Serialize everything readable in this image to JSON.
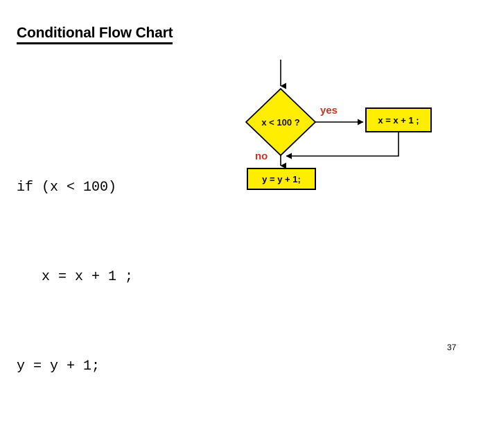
{
  "slide": {
    "title": "Conditional Flow Chart",
    "page_number": "37",
    "background_color": "#ffffff"
  },
  "code": {
    "lines": [
      "if (x < 100)",
      "   x = x + 1 ;",
      "y = y + 1;"
    ],
    "line1": "if (x < 100)",
    "line2": "   x = x + 1 ;",
    "line3": "y = y + 1;",
    "text_color": "#000000"
  },
  "chart_data": {
    "type": "diagram",
    "title": "Conditional Flow Chart",
    "diagram_kind": "flowchart",
    "colors": {
      "node_fill": "#ffee00",
      "node_stroke": "#000000",
      "node_text": "#1a1008",
      "branch_label": "#cc3322",
      "connector": "#000000"
    },
    "nodes": [
      {
        "id": "entry",
        "shape": "arrow-in",
        "label": ""
      },
      {
        "id": "decision",
        "shape": "diamond",
        "label": "x < 100 ?",
        "fill": "#ffee00",
        "text_color": "#1a1008"
      },
      {
        "id": "then",
        "shape": "rectangle",
        "label": "x = x + 1 ;",
        "fill": "#ffee00",
        "text_color": "#000000"
      },
      {
        "id": "after",
        "shape": "rectangle",
        "label": "y = y + 1;",
        "fill": "#ffee00",
        "text_color": "#000000"
      }
    ],
    "edges": [
      {
        "from": "entry",
        "to": "decision",
        "label": ""
      },
      {
        "from": "decision",
        "to": "then",
        "label": "yes",
        "label_color": "#cc3322"
      },
      {
        "from": "then",
        "to": "after",
        "label": ""
      },
      {
        "from": "decision",
        "to": "after",
        "label": "no",
        "label_color": "#cc3322"
      }
    ],
    "labels": {
      "decision": "x < 100 ?",
      "then_box": "x = x + 1 ;",
      "after_box": "y = y + 1;",
      "yes": "yes",
      "no": "no"
    }
  }
}
